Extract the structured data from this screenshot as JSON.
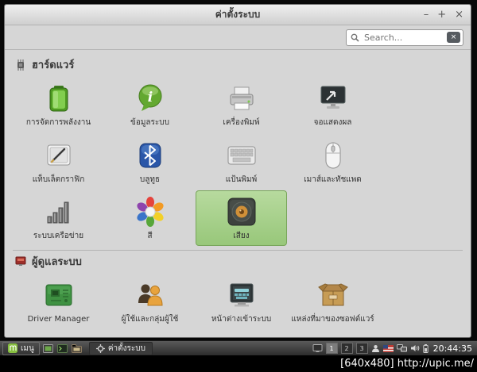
{
  "window": {
    "title": "ค่าตั้งระบบ",
    "controls": {
      "minimize": "–",
      "maximize": "+",
      "close": "×"
    },
    "search": {
      "placeholder": "Search..."
    }
  },
  "sections": [
    {
      "label": "ฮาร์ดแวร์",
      "icon": "hardware-chip-icon",
      "items": [
        {
          "label": "การจัดการพลังงาน",
          "icon": "battery-icon"
        },
        {
          "label": "ข้อมูลระบบ",
          "icon": "info-bubble-icon"
        },
        {
          "label": "เครื่องพิมพ์",
          "icon": "printer-icon"
        },
        {
          "label": "จอแสดงผล",
          "icon": "display-icon"
        },
        {
          "label": "แท็บเล็ตกราฟิก",
          "icon": "graphics-tablet-icon"
        },
        {
          "label": "บลูทูธ",
          "icon": "bluetooth-icon"
        },
        {
          "label": "แป้นพิมพ์",
          "icon": "keyboard-icon"
        },
        {
          "label": "เมาส์และทัชแพด",
          "icon": "mouse-icon"
        },
        {
          "label": "ระบบเครือข่าย",
          "icon": "network-bars-icon"
        },
        {
          "label": "สี",
          "icon": "color-flower-icon"
        },
        {
          "label": "เสียง",
          "icon": "speaker-icon",
          "selected": true
        }
      ]
    },
    {
      "label": "ผู้ดูแลระบบ",
      "icon": "administration-icon",
      "items": [
        {
          "label": "Driver Manager",
          "icon": "driver-board-icon"
        },
        {
          "label": "ผู้ใช้และกลุ่มผู้ใช้",
          "icon": "users-icon"
        },
        {
          "label": "หน้าต่างเข้าระบบ",
          "icon": "login-window-icon"
        },
        {
          "label": "แหล่งที่มาของซอฟต์แวร์",
          "icon": "software-sources-box-icon"
        }
      ]
    }
  ],
  "taskbar": {
    "menu_label": "เมนู",
    "task_label": "ค่าตั้งระบบ",
    "workspaces": [
      "1",
      "2",
      "3"
    ],
    "clock": "20:44:35"
  },
  "watermark": "[640x480] http://upic.me/",
  "colors": {
    "selection_green": "#a6cc8b",
    "selection_border": "#78a55a",
    "mint_green": "#69a53f",
    "window_bg": "#d6d6d6",
    "taskbar_dark": "#2c2c2c"
  }
}
